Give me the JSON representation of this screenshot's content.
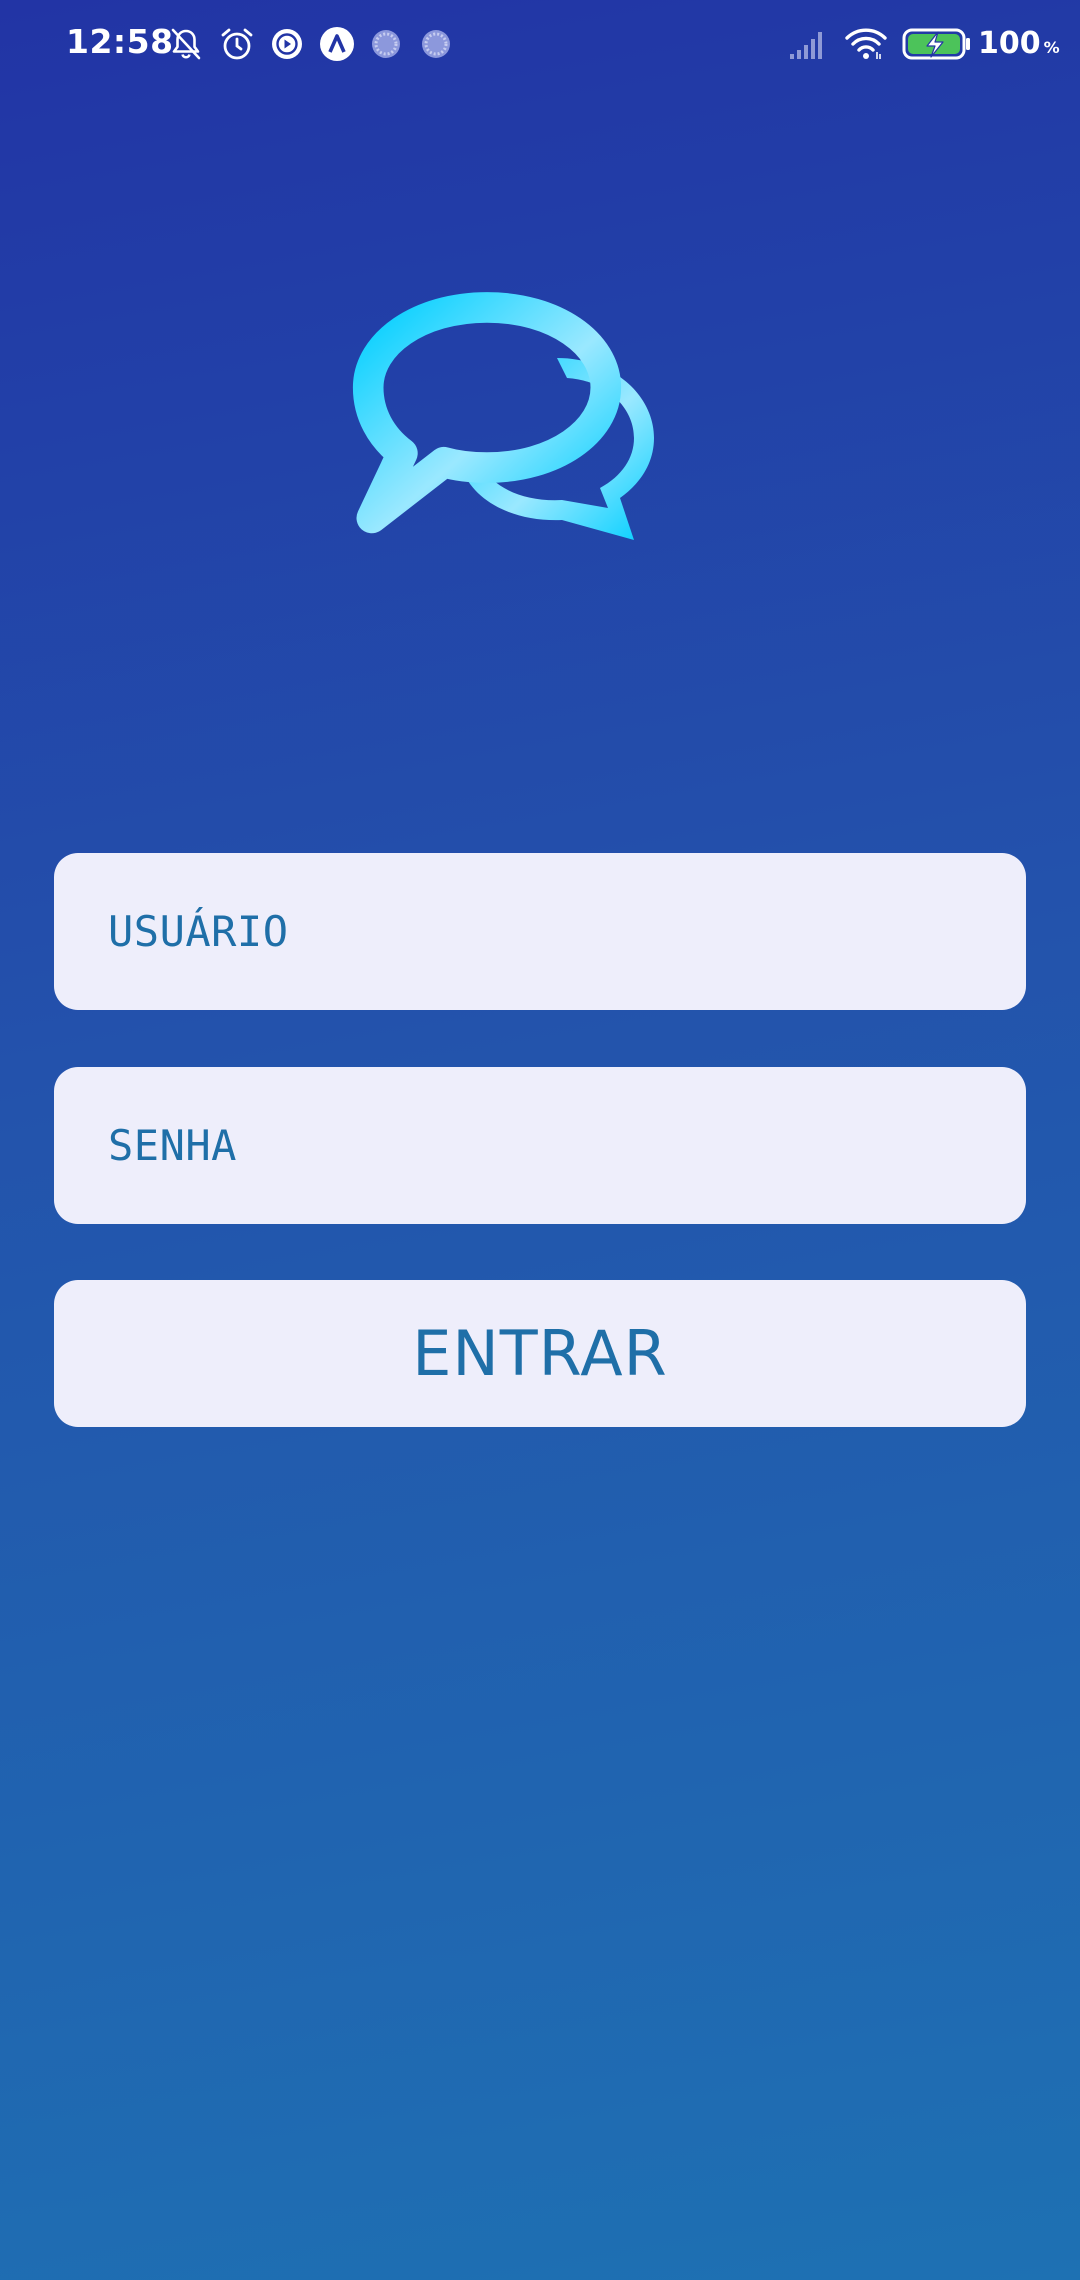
{
  "status_bar": {
    "time": "12:58",
    "battery_percent": "100",
    "battery_unit": "%",
    "icons_left": [
      "bell-muted-icon",
      "alarm-icon",
      "play-circle-icon",
      "app-a-icon",
      "loading-dot-icon",
      "loading-dot-icon"
    ],
    "icons_right": [
      "signal-icon",
      "wifi-icon",
      "battery-charging-icon"
    ]
  },
  "logo": {
    "icon": "chat-bubbles-icon",
    "colors": [
      "#00cfff",
      "#9ae8ff"
    ]
  },
  "login_form": {
    "username_placeholder": "USUÁRIO",
    "username_value": "",
    "password_placeholder": "SENHA",
    "password_value": "",
    "submit_label": "ENTRAR"
  },
  "colors": {
    "background_top": "#2234a5",
    "background_bottom": "#1e71b3",
    "field_background": "#eeeefb",
    "field_text": "#1f6fa8",
    "battery_fill": "#4cc35a"
  }
}
